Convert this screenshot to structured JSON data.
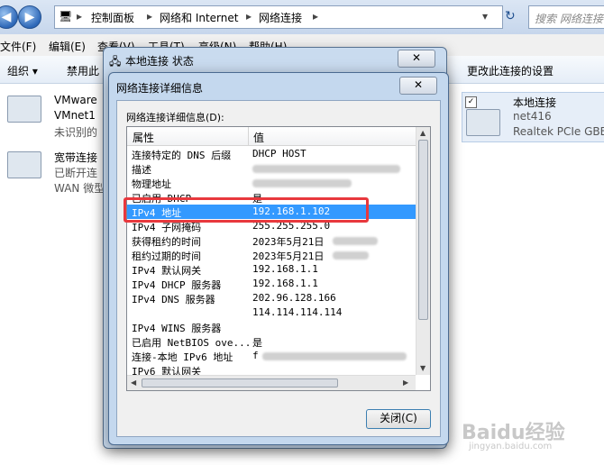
{
  "explorer": {
    "breadcrumb": [
      "控制面板",
      "网络和 Internet",
      "网络连接"
    ],
    "search_placeholder": "搜索 网络连接",
    "menu": [
      "文件(F)",
      "编辑(E)",
      "查看(V)",
      "工具(T)",
      "高级(N)",
      "帮助(H)"
    ],
    "toolbar": {
      "organize": "组织 ▾",
      "disable": "禁用此",
      "change_settings": "更改此连接的设置"
    },
    "connections": [
      {
        "name": "VMware",
        "line2": "VMnet1",
        "line3": "未识别的"
      },
      {
        "name": "宽带连接",
        "line2": "已断开连",
        "line3": "WAN 微型"
      },
      {
        "name": "本地连接",
        "line2": "net416",
        "line3": "Realtek PCIe GBE"
      }
    ]
  },
  "status_dialog": {
    "title": "本地连接 状态",
    "close": "✕"
  },
  "details_dialog": {
    "title": "网络连接详细信息",
    "close": "✕",
    "group_label": "网络连接详细信息(D):",
    "columns": [
      "属性",
      "值"
    ],
    "rows": [
      {
        "prop": "连接特定的 DNS 后缀",
        "value": "DHCP HOST"
      },
      {
        "prop": "描述",
        "value": ""
      },
      {
        "prop": "物理地址",
        "value": ""
      },
      {
        "prop": "已启用 DHCP",
        "value": "是"
      },
      {
        "prop": "IPv4 地址",
        "value": "192.168.1.102"
      },
      {
        "prop": "IPv4 子网掩码",
        "value": "255.255.255.0"
      },
      {
        "prop": "获得租约的时间",
        "value": "2023年5月21日"
      },
      {
        "prop": "租约过期的时间",
        "value": "2023年5月21日"
      },
      {
        "prop": "IPv4 默认网关",
        "value": "192.168.1.1"
      },
      {
        "prop": "IPv4 DHCP 服务器",
        "value": "192.168.1.1"
      },
      {
        "prop": "IPv4 DNS 服务器",
        "value": "202.96.128.166"
      },
      {
        "prop": "",
        "value": "114.114.114.114"
      },
      {
        "prop": "IPv4 WINS 服务器",
        "value": ""
      },
      {
        "prop": "已启用 NetBIOS ove...",
        "value": "是"
      },
      {
        "prop": "连接-本地 IPv6 地址",
        "value": "f"
      },
      {
        "prop": "IPv6 默认网关",
        "value": ""
      }
    ],
    "selected_row_index": 4,
    "close_button": "关闭(C)"
  },
  "watermark": {
    "text": "Baidu经验",
    "sub": "jingyan.baidu.com"
  },
  "colors": {
    "selection": "#3399ff",
    "highlight_box": "#e8383d"
  }
}
